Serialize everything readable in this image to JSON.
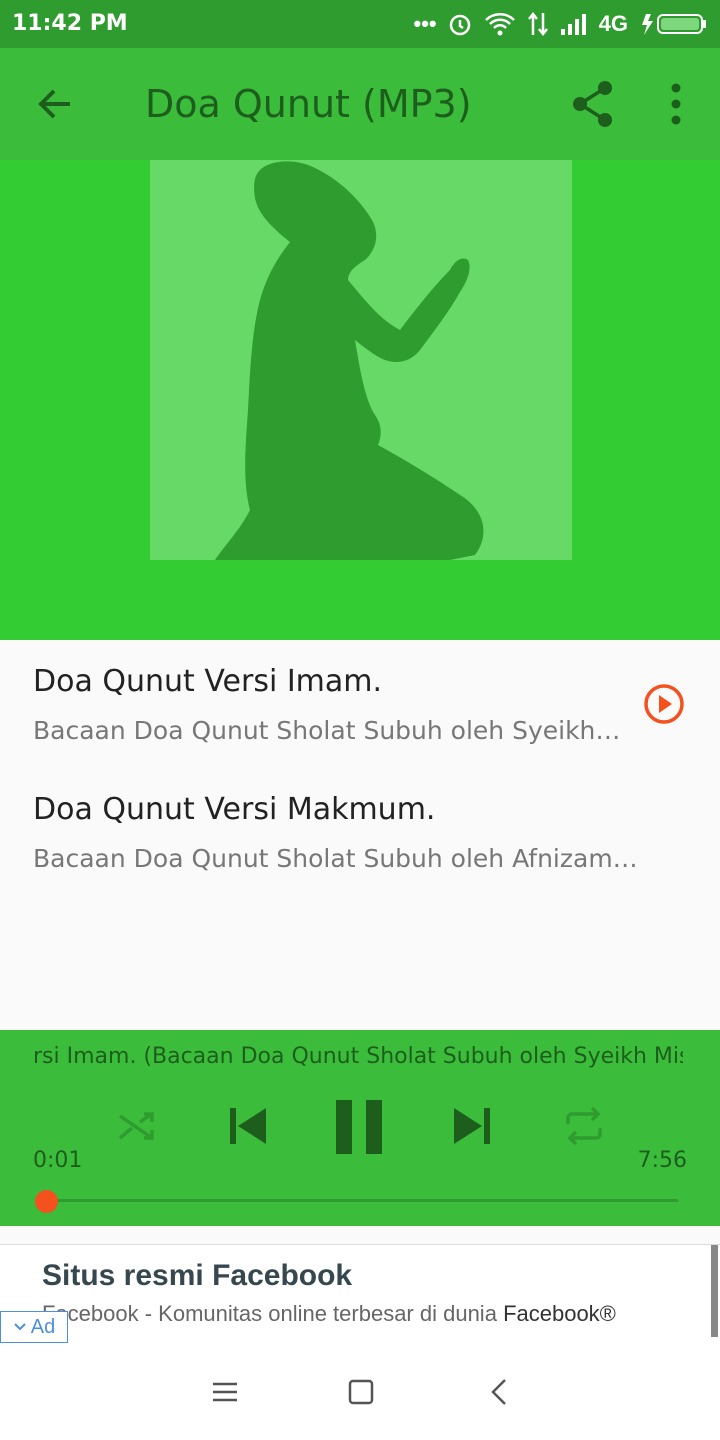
{
  "status_bar": {
    "time": "11:42 PM",
    "network": "4G"
  },
  "app_bar": {
    "title": "Doa Qunut (MP3)",
    "back_icon": "arrow-back-icon",
    "share_icon": "share-icon",
    "more_icon": "more-vert-icon"
  },
  "tracks": [
    {
      "title": "Doa Qunut Versi Imam.",
      "subtitle": "Bacaan Doa Qunut Sholat Subuh oleh Syeikh…",
      "playing": true
    },
    {
      "title": "Doa Qunut Versi Makmum.",
      "subtitle": "Bacaan Doa Qunut Sholat Subuh oleh Afnizam…",
      "playing": false
    }
  ],
  "player": {
    "now_playing": "rsi Imam. (Bacaan Doa Qunut Sholat Subuh oleh Syeikh Misyari",
    "elapsed": "0:01",
    "duration": "7:56",
    "progress_fraction": 0.002
  },
  "ad": {
    "headline": "Situs resmi Facebook",
    "description": "Facebook - Komunitas online terbesar di dunia",
    "brand": "Facebook®",
    "badge": "Ad"
  },
  "colors": {
    "primary": "#3bbd3b",
    "primary_dark": "#2e9c2e",
    "art_bg": "#33cc33",
    "accent": "#f4511e",
    "icon_dark": "#1d5e1d"
  }
}
